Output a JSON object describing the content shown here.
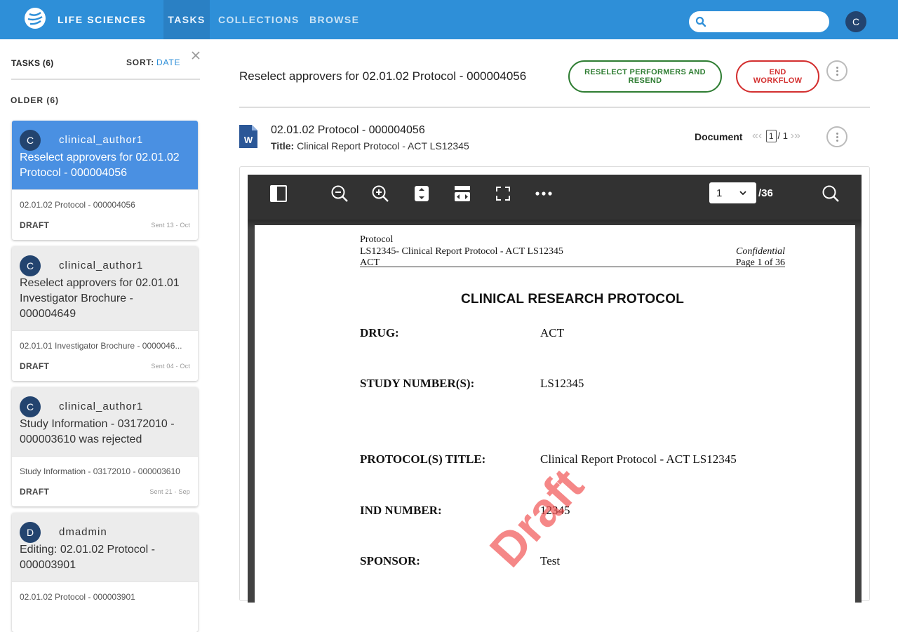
{
  "topbar": {
    "brand": "LIFE SCIENCES",
    "tabs": [
      "TASKS",
      "COLLECTIONS",
      "BROWSE"
    ],
    "active_tab": "TASKS",
    "search_placeholder": "",
    "user_initial": "C",
    "color": "#2e8fd8"
  },
  "sidebar": {
    "tasks_label": "TASKS (6)",
    "sort_label": "SORT:",
    "sort_value": "DATE",
    "group_label": "OLDER (6)",
    "cards": [
      {
        "initial": "C",
        "user": "clinical_author1",
        "title": "Reselect approvers for 02.01.02 Protocol - 000004056",
        "subtitle": "02.01.02 Protocol - 000004056",
        "status": "DRAFT",
        "sent": "Sent 13 - Oct"
      },
      {
        "initial": "C",
        "user": "clinical_author1",
        "title": "Reselect approvers for 02.01.01 Investigator Brochure - 000004649",
        "subtitle": "02.01.01 Investigator Brochure - 0000046...",
        "status": "DRAFT",
        "sent": "Sent 04 - Oct"
      },
      {
        "initial": "C",
        "user": "clinical_author1",
        "title": "Study Information - 03172010 - 000003610 was rejected",
        "subtitle": "Study Information - 03172010 - 000003610",
        "status": "DRAFT",
        "sent": "Sent 21 - Sep"
      },
      {
        "initial": "D",
        "user": "dmadmin",
        "title": "Editing: 02.01.02 Protocol - 000003901",
        "subtitle": "02.01.02 Protocol - 000003901",
        "status": "",
        "sent": ""
      }
    ]
  },
  "main": {
    "title": "Reselect approvers for 02.01.02 Protocol - 000004056",
    "btn_reselect": "RESELECT PERFORMERS AND RESEND",
    "btn_end": "END WORKFLOW",
    "doc_name": "02.01.02 Protocol - 000004056",
    "doc_title_label": "Title:",
    "doc_title_value": "Clinical Report Protocol - ACT LS12345",
    "doc_label": "Document",
    "pager_current": "1",
    "pager_total": "/ 1"
  },
  "viewer": {
    "page_select_value": "1",
    "page_total": "/36"
  },
  "pdf": {
    "header_left_1": "Protocol",
    "header_left_2": "LS12345- Clinical Report Protocol - ACT LS12345",
    "header_left_3": "ACT",
    "header_right_1": "Confidential",
    "header_right_2": "Page 1 of 36",
    "heading": "CLINICAL RESEARCH PROTOCOL",
    "fields": [
      {
        "label": "DRUG:",
        "value": "ACT"
      },
      {
        "label": "STUDY NUMBER(S):",
        "value": "LS12345"
      },
      {
        "label": "PROTOCOL(S) TITLE:",
        "value": "Clinical Report Protocol - ACT LS12345"
      },
      {
        "label": "IND NUMBER:",
        "value": "12345"
      },
      {
        "label": "SPONSOR:",
        "value": "Test"
      }
    ],
    "watermark": "Draft"
  }
}
